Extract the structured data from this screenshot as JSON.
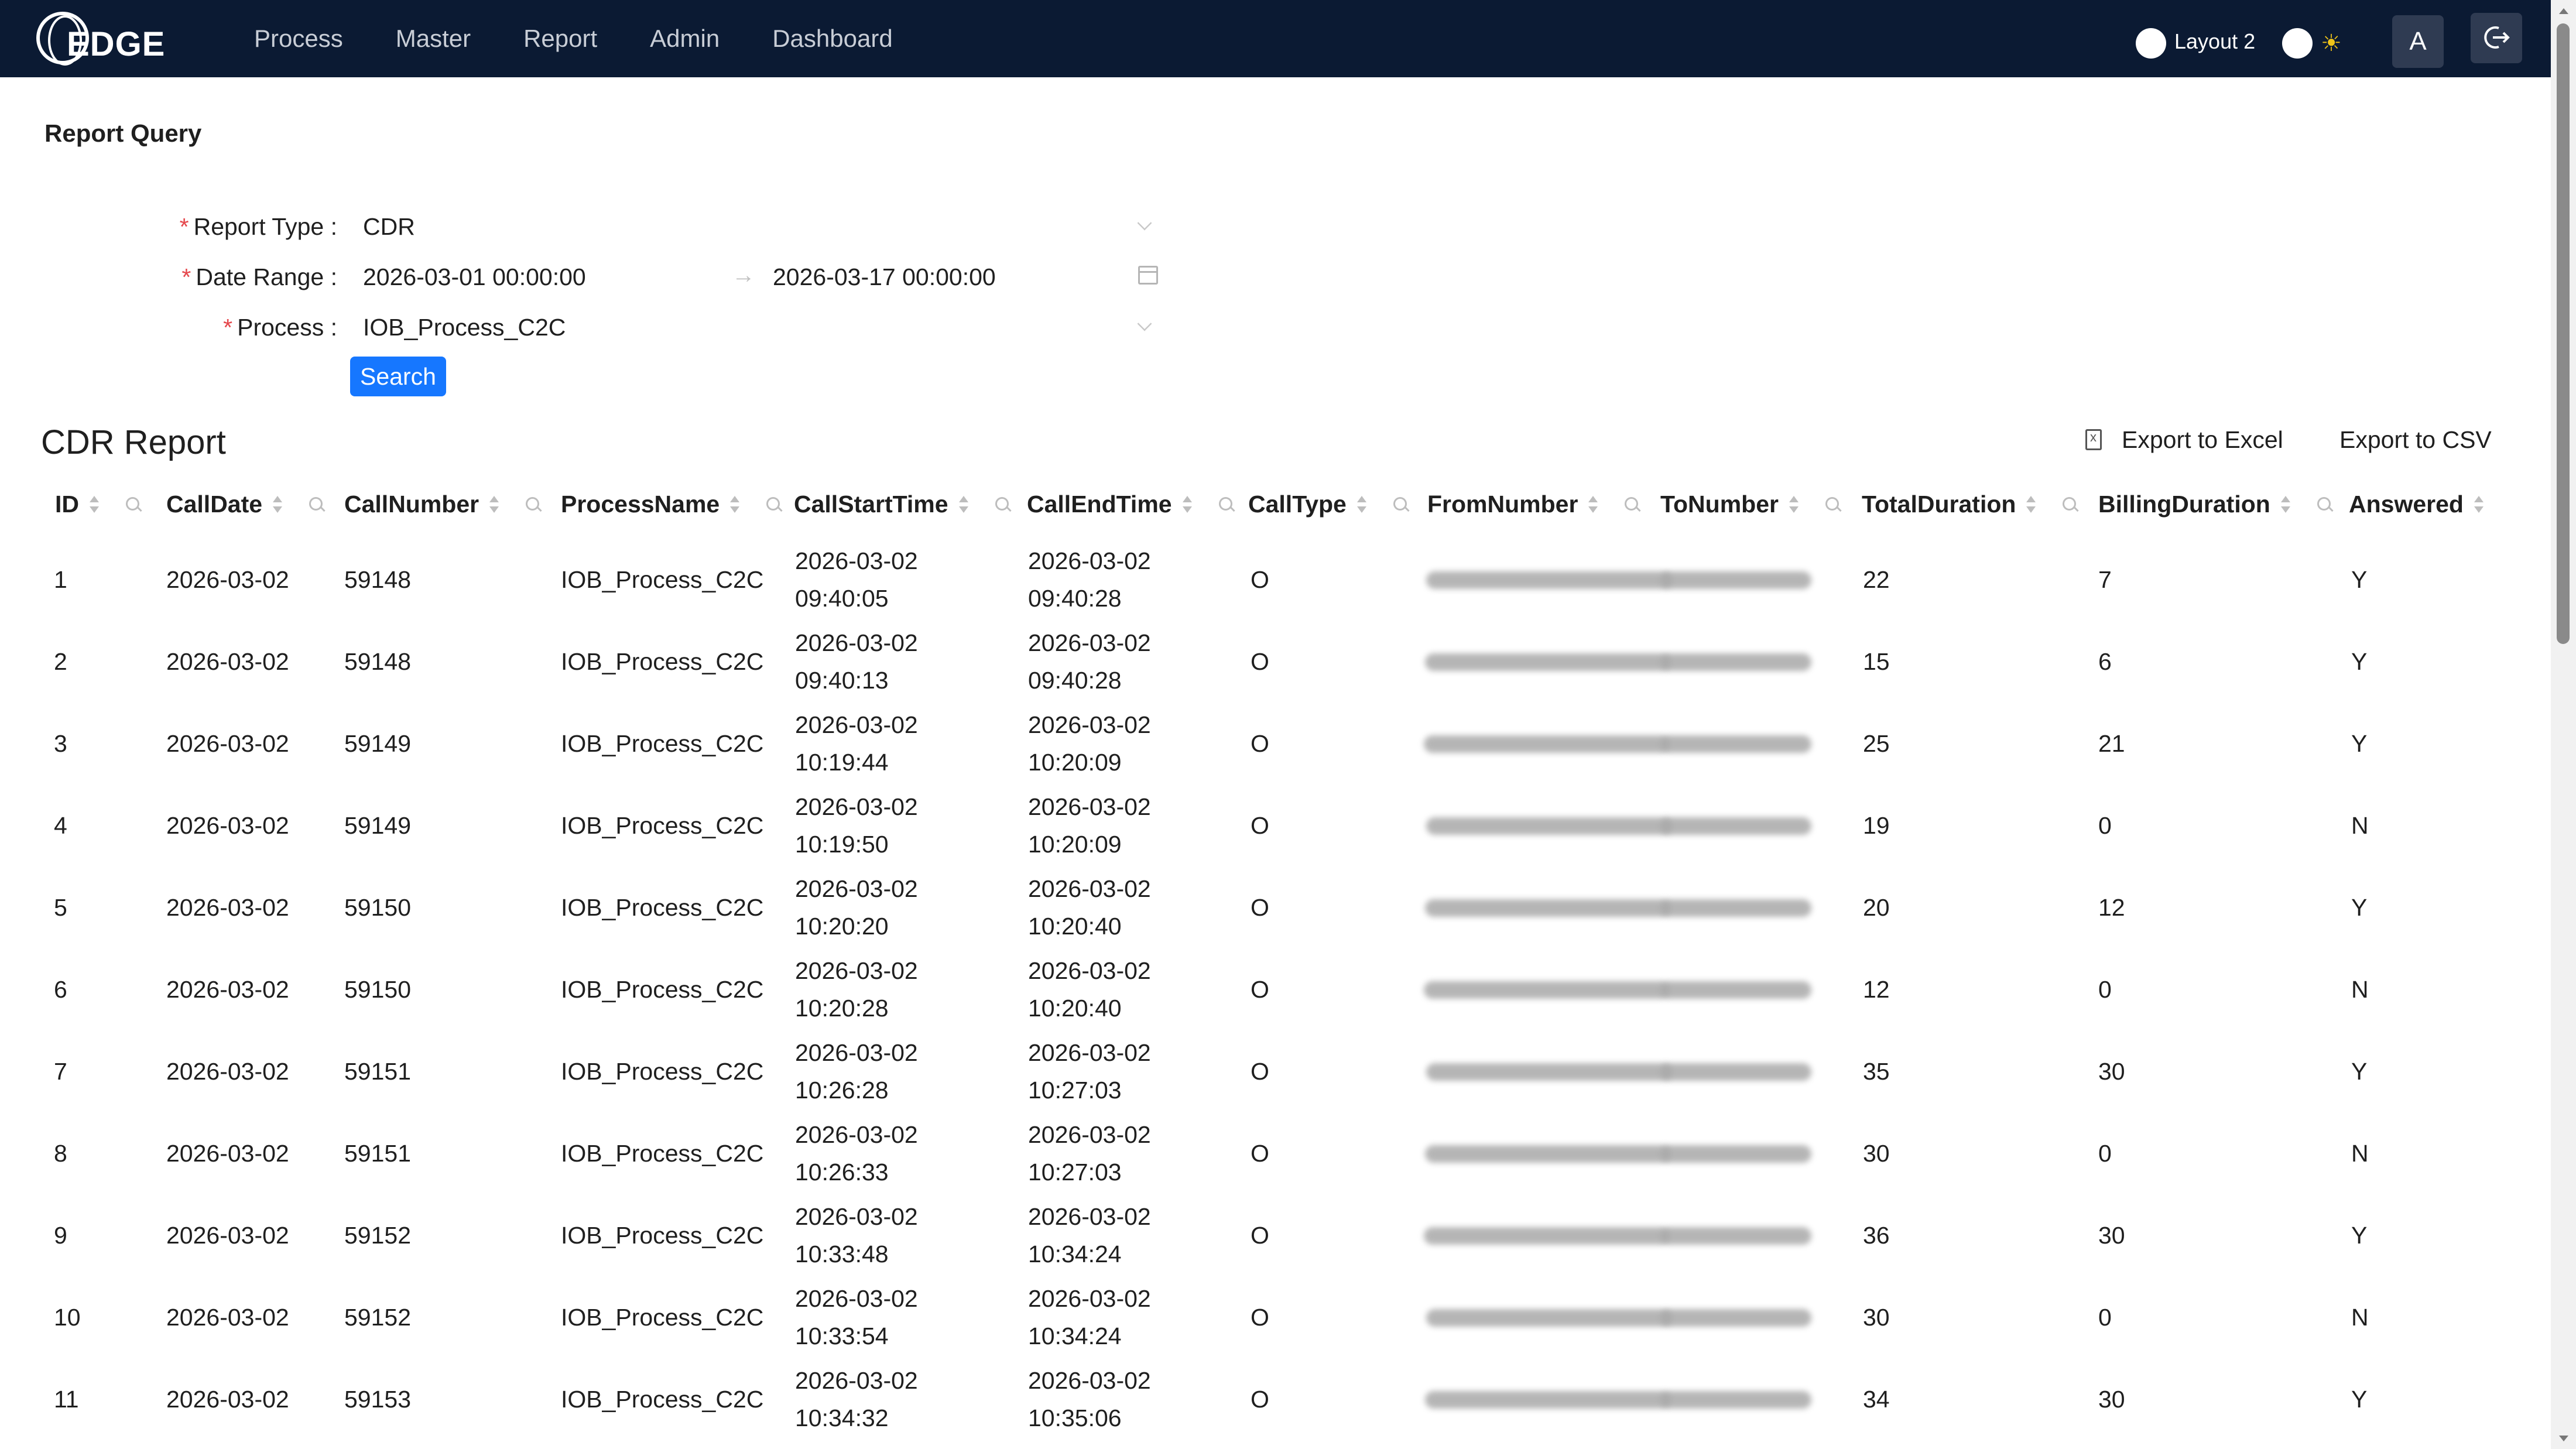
{
  "nav": {
    "logo_text": "EDGE",
    "items": [
      "Process",
      "Master",
      "Report",
      "Admin",
      "Dashboard"
    ],
    "layout_label": "Layout 2",
    "avatar_letter": "A"
  },
  "query": {
    "title": "Report Query",
    "report_type_label": "Report Type",
    "report_type_value": "CDR",
    "date_range_label": "Date Range",
    "date_start": "2026-03-01 00:00:00",
    "date_end": "2026-03-17 00:00:00",
    "range_separator": "→",
    "process_label": "Process",
    "process_value": "IOB_Process_C2C",
    "search_label": "Search"
  },
  "report": {
    "title": "CDR Report",
    "export_excel": "Export to Excel",
    "export_csv": "Export to CSV",
    "columns": [
      "ID",
      "CallDate",
      "CallNumber",
      "ProcessName",
      "CallStartTime",
      "CallEndTime",
      "CallType",
      "FromNumber",
      "ToNumber",
      "TotalDuration",
      "BillingDuration",
      "Answered"
    ],
    "rows": [
      {
        "id": "1",
        "date": "2026-03-02",
        "number": "59148",
        "process": "IOB_Process_C2C",
        "start_d": "2026-03-02",
        "start_t": "09:40:05",
        "end_d": "2026-03-02",
        "end_t": "09:40:28",
        "type": "O",
        "total": "22",
        "billing": "7",
        "answered": "Y"
      },
      {
        "id": "2",
        "date": "2026-03-02",
        "number": "59148",
        "process": "IOB_Process_C2C",
        "start_d": "2026-03-02",
        "start_t": "09:40:13",
        "end_d": "2026-03-02",
        "end_t": "09:40:28",
        "type": "O",
        "total": "15",
        "billing": "6",
        "answered": "Y"
      },
      {
        "id": "3",
        "date": "2026-03-02",
        "number": "59149",
        "process": "IOB_Process_C2C",
        "start_d": "2026-03-02",
        "start_t": "10:19:44",
        "end_d": "2026-03-02",
        "end_t": "10:20:09",
        "type": "O",
        "total": "25",
        "billing": "21",
        "answered": "Y"
      },
      {
        "id": "4",
        "date": "2026-03-02",
        "number": "59149",
        "process": "IOB_Process_C2C",
        "start_d": "2026-03-02",
        "start_t": "10:19:50",
        "end_d": "2026-03-02",
        "end_t": "10:20:09",
        "type": "O",
        "total": "19",
        "billing": "0",
        "answered": "N"
      },
      {
        "id": "5",
        "date": "2026-03-02",
        "number": "59150",
        "process": "IOB_Process_C2C",
        "start_d": "2026-03-02",
        "start_t": "10:20:20",
        "end_d": "2026-03-02",
        "end_t": "10:20:40",
        "type": "O",
        "total": "20",
        "billing": "12",
        "answered": "Y"
      },
      {
        "id": "6",
        "date": "2026-03-02",
        "number": "59150",
        "process": "IOB_Process_C2C",
        "start_d": "2026-03-02",
        "start_t": "10:20:28",
        "end_d": "2026-03-02",
        "end_t": "10:20:40",
        "type": "O",
        "total": "12",
        "billing": "0",
        "answered": "N"
      },
      {
        "id": "7",
        "date": "2026-03-02",
        "number": "59151",
        "process": "IOB_Process_C2C",
        "start_d": "2026-03-02",
        "start_t": "10:26:28",
        "end_d": "2026-03-02",
        "end_t": "10:27:03",
        "type": "O",
        "total": "35",
        "billing": "30",
        "answered": "Y"
      },
      {
        "id": "8",
        "date": "2026-03-02",
        "number": "59151",
        "process": "IOB_Process_C2C",
        "start_d": "2026-03-02",
        "start_t": "10:26:33",
        "end_d": "2026-03-02",
        "end_t": "10:27:03",
        "type": "O",
        "total": "30",
        "billing": "0",
        "answered": "N"
      },
      {
        "id": "9",
        "date": "2026-03-02",
        "number": "59152",
        "process": "IOB_Process_C2C",
        "start_d": "2026-03-02",
        "start_t": "10:33:48",
        "end_d": "2026-03-02",
        "end_t": "10:34:24",
        "type": "O",
        "total": "36",
        "billing": "30",
        "answered": "Y"
      },
      {
        "id": "10",
        "date": "2026-03-02",
        "number": "59152",
        "process": "IOB_Process_C2C",
        "start_d": "2026-03-02",
        "start_t": "10:33:54",
        "end_d": "2026-03-02",
        "end_t": "10:34:24",
        "type": "O",
        "total": "30",
        "billing": "0",
        "answered": "N"
      },
      {
        "id": "11",
        "date": "2026-03-02",
        "number": "59153",
        "process": "IOB_Process_C2C",
        "start_d": "2026-03-02",
        "start_t": "10:34:32",
        "end_d": "2026-03-02",
        "end_t": "10:35:06",
        "type": "O",
        "total": "34",
        "billing": "30",
        "answered": "Y"
      }
    ]
  },
  "icons": {
    "sort": "sort-icon",
    "filter": "search-icon",
    "calendar": "calendar-icon",
    "excel": "file-excel-icon",
    "theme": "sun-icon",
    "logout": "logout-icon"
  },
  "colors": {
    "topbar": "#0b1a33",
    "primary": "#1677ff",
    "required": "#e5484d"
  }
}
